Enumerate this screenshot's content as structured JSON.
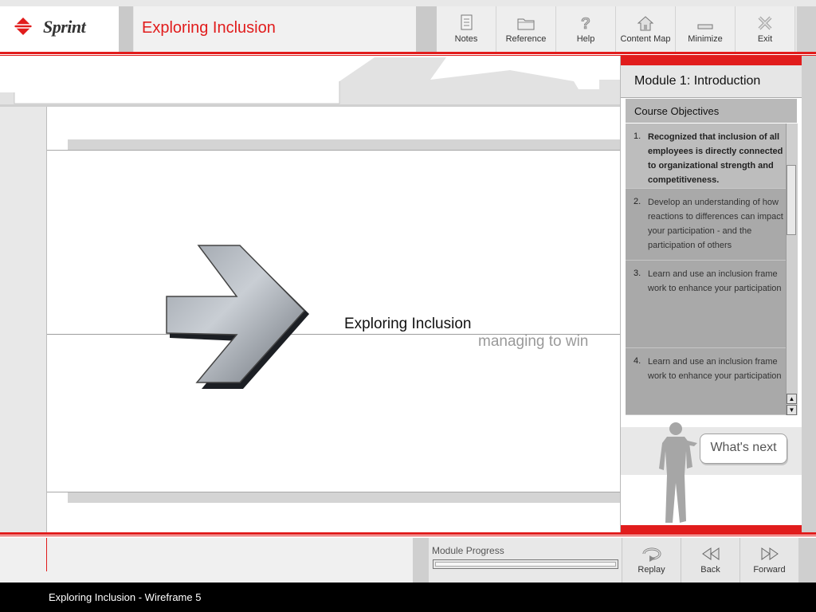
{
  "brand": {
    "name": "Sprint"
  },
  "app": {
    "title": "Exploring Inclusion"
  },
  "toolbar": [
    {
      "label": "Notes",
      "icon": "notes-icon"
    },
    {
      "label": "Reference",
      "icon": "folder-icon"
    },
    {
      "label": "Help",
      "icon": "help-icon"
    },
    {
      "label": "Content Map",
      "icon": "content-map-icon"
    },
    {
      "label": "Minimize",
      "icon": "minimize-icon"
    },
    {
      "label": "Exit",
      "icon": "close-icon"
    }
  ],
  "hero": {
    "title": "Exploring Inclusion",
    "subtitle": "managing to win"
  },
  "panel": {
    "module_title": "Module 1: Introduction",
    "objectives_heading": "Course Objectives",
    "objectives": [
      {
        "num": "1.",
        "text": "Recognized that inclusion of all employees is directly connected to organizational strength and competitiveness.",
        "active": true
      },
      {
        "num": "2.",
        "text": "Develop an understanding of how reactions to differences can impact your participation - and the participation of others",
        "active": false
      },
      {
        "num": "3.",
        "text": "Learn and use an inclusion frame work to enhance your participation",
        "active": false
      },
      {
        "num": "4.",
        "text": "Learn and use an inclusion frame work to enhance your participation",
        "active": false
      }
    ],
    "whats_next": "What's next"
  },
  "footer": {
    "progress_label": "Module Progress",
    "progress": 0,
    "nav": [
      {
        "label": "Replay",
        "icon": "replay-icon"
      },
      {
        "label": "Back",
        "icon": "back-icon"
      },
      {
        "label": "Forward",
        "icon": "forward-icon"
      }
    ]
  },
  "status": {
    "text": "Exploring Inclusion - Wireframe 5"
  },
  "colors": {
    "accent": "#e11c1c",
    "panel_grey": "#a9a9a9",
    "background": "#e8e8e8"
  }
}
